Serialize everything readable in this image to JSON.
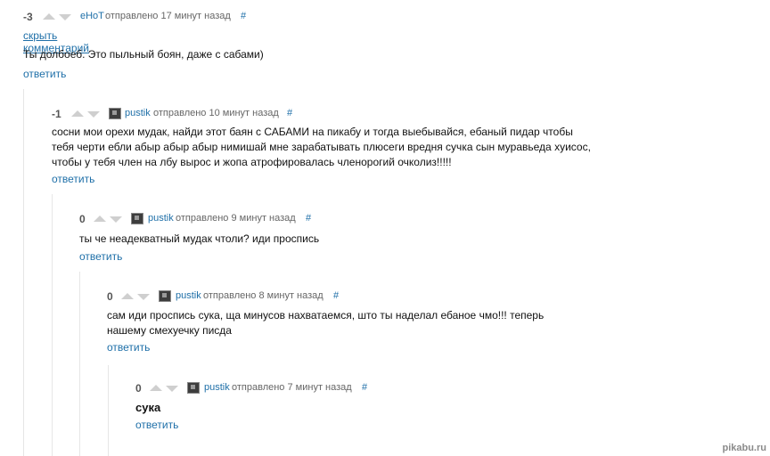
{
  "comments": [
    {
      "rating": "-3",
      "author": "eHoT",
      "time": "отправлено 17 минут назад",
      "hash": "#",
      "hide": "скрыть комментарий",
      "text": [
        "Ты долбоеб. Это пыльный боян, даже с сабами)"
      ],
      "reply": "ответить"
    },
    {
      "rating": "-1",
      "author": "pustik",
      "time": "отправлено 10 минут назад",
      "hash": "#",
      "text": [
        "сосни мои орехи мудак, найди этот баян с САБАМИ на пикабу и тогда выебывайся, ебаный пидар чтобы",
        "тебя черти ебли абыр абыр абыр нимишай мне зарабатывать плюсеги вредня сучка сын муравьеда хуисос,",
        "чтобы у тебя член на лбу вырос и жопа атрофировалась членорогий очколиз!!!!!"
      ],
      "reply": "ответить"
    },
    {
      "rating": "0",
      "author": "pustik",
      "time": "отправлено 9 минут назад",
      "hash": "#",
      "text": [
        "ты че неадекватный мудак чтоли? иди проспись"
      ],
      "reply": "ответить"
    },
    {
      "rating": "0",
      "author": "pustik",
      "time": "отправлено 8 минут назад",
      "hash": "#",
      "text": [
        "сам иди проспись сука, ща минусов нахватаемся, што ты наделал ебаное чмо!!! теперь",
        "нашему смехуечку писда"
      ],
      "reply": "ответить"
    },
    {
      "rating": "0",
      "author": "pustik",
      "time": "отправлено 7 минут назад",
      "hash": "#",
      "text": [
        "сука"
      ],
      "reply": "ответить"
    }
  ],
  "watermark": "pikabu.ru"
}
